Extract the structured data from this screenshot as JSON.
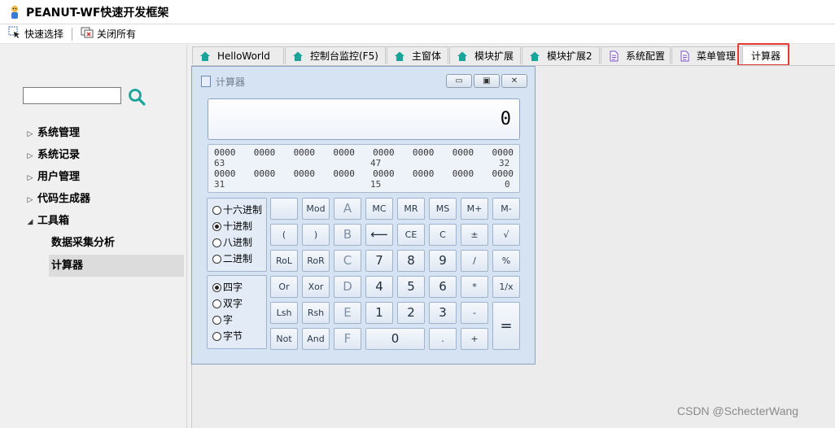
{
  "app": {
    "title": "PEANUT-WF快速开发框架"
  },
  "toolbar": {
    "quick_select": "快速选择",
    "close_all": "关闭所有"
  },
  "sidebar": {
    "search_placeholder": "",
    "tree": [
      {
        "label": "系统管理",
        "expanded": false
      },
      {
        "label": "系统记录",
        "expanded": false
      },
      {
        "label": "用户管理",
        "expanded": false
      },
      {
        "label": "代码生成器",
        "expanded": false
      },
      {
        "label": "工具箱",
        "expanded": true
      }
    ],
    "children": [
      {
        "label": "数据采集分析"
      },
      {
        "label": "计算器",
        "selected": true
      }
    ]
  },
  "tabs": [
    {
      "label": "HelloWorld",
      "icon": "house-icon"
    },
    {
      "label": "控制台监控(F5)",
      "icon": "house-icon"
    },
    {
      "label": "主窗体",
      "icon": "house-icon"
    },
    {
      "label": "模块扩展",
      "icon": "house-icon"
    },
    {
      "label": "模块扩展2",
      "icon": "house-icon"
    },
    {
      "label": "系统配置",
      "icon": "document-icon"
    },
    {
      "label": "菜单管理",
      "icon": "document-icon"
    },
    {
      "label": "计算器",
      "icon": "",
      "active": true
    }
  ],
  "calculator": {
    "title": "计算器",
    "display": "0",
    "bits_row1": [
      "0000",
      "0000",
      "0000",
      "0000",
      "0000",
      "0000",
      "0000",
      "0000"
    ],
    "bits_row2": [
      "0000",
      "0000",
      "0000",
      "0000",
      "0000",
      "0000",
      "0000",
      "0000"
    ],
    "bit_idx": {
      "r1_left": "63",
      "r1_mid": "47",
      "r1_right": "32",
      "r2_left": "31",
      "r2_mid": "15",
      "r2_right": "0"
    },
    "base_radios": [
      {
        "label": "十六进制",
        "checked": false
      },
      {
        "label": "十进制",
        "checked": true
      },
      {
        "label": "八进制",
        "checked": false
      },
      {
        "label": "二进制",
        "checked": false
      }
    ],
    "word_radios": [
      {
        "label": "四字",
        "checked": true
      },
      {
        "label": "双字",
        "checked": false
      },
      {
        "label": "字",
        "checked": false
      },
      {
        "label": "字节",
        "checked": false
      }
    ],
    "keys": {
      "blank": "",
      "mod": "Mod",
      "a": "A",
      "mc": "MC",
      "mr": "MR",
      "ms": "MS",
      "mplus": "M+",
      "mminus": "M-",
      "lparen": "(",
      "rparen": ")",
      "b": "B",
      "back": "⟵",
      "ce": "CE",
      "c": "C",
      "plusminus": "±",
      "sqrt": "√",
      "rol": "RoL",
      "ror": "RoR",
      "c_hex": "C",
      "n7": "7",
      "n8": "8",
      "n9": "9",
      "div": "/",
      "pct": "%",
      "or": "Or",
      "xor": "Xor",
      "d": "D",
      "n4": "4",
      "n5": "5",
      "n6": "6",
      "mul": "*",
      "recip": "1/x",
      "lsh": "Lsh",
      "rsh": "Rsh",
      "e": "E",
      "n1": "1",
      "n2": "2",
      "n3": "3",
      "minus": "-",
      "eq": "=",
      "not": "Not",
      "and": "And",
      "f": "F",
      "n0": "0",
      "dot": ".",
      "plus": "+"
    }
  },
  "watermark": "CSDN @SchecterWang"
}
